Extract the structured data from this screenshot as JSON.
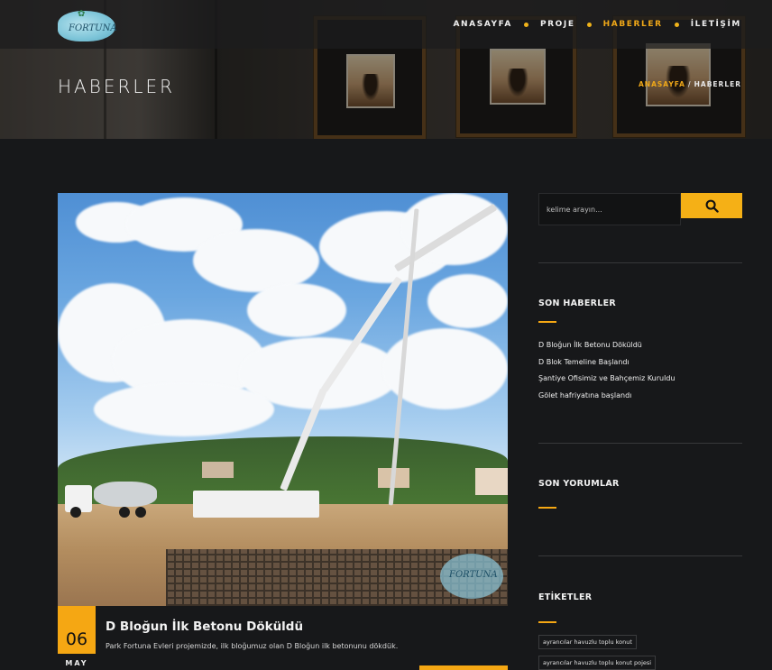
{
  "header": {
    "logo_text": "FORTUNA",
    "nav": [
      {
        "label": "ANASAYFA"
      },
      {
        "label": "PROJE"
      },
      {
        "label": "HABERLER"
      },
      {
        "label": "İLETİŞİM"
      }
    ],
    "active_nav_index": 2,
    "page_title": "HABERLER",
    "breadcrumb": {
      "home": "ANASAYFA",
      "separator": "/",
      "current": "HABERLER"
    }
  },
  "post": {
    "watermark_text": "FORTUNA",
    "day": "06",
    "month": "MAY",
    "title": "D Bloğun İlk Betonu Döküldü",
    "excerpt": "Park Fortuna Evleri projemizde, ilk bloğumuz olan D Bloğun ilk betonunu dökdük."
  },
  "sidebar": {
    "search_placeholder": "kelime arayın...",
    "recent_title": "SON HABERLER",
    "recent_posts": [
      "D Bloğun İlk Betonu Döküldü",
      "D Blok Temeline Başlandı",
      "Şantiye Ofisimiz ve Bahçemiz Kuruldu",
      "Gölet hafriyatına başlandı"
    ],
    "comments_title": "SON YORUMLAR",
    "tags_title": "ETİKETLER",
    "tags": [
      "ayrancılar havuzlu toplu konut",
      "ayrancılar havuzlu toplu konut pojesi"
    ]
  },
  "colors": {
    "accent": "#f5a713",
    "background": "#17181a"
  },
  "icons": {
    "search": "search-icon"
  }
}
